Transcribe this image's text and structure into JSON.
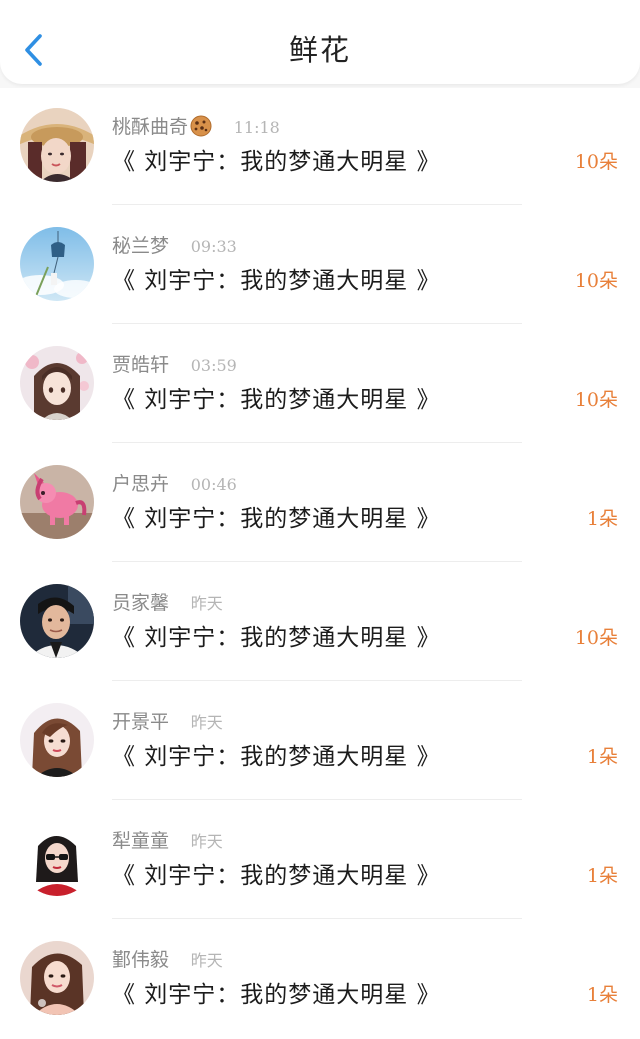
{
  "header": {
    "title": "鲜花",
    "back_icon": "chevron-left-icon"
  },
  "colors": {
    "accent": "#2f8fe3",
    "count": "#e8803a",
    "name": "#8a8a8a",
    "time": "#b5b5b5",
    "message": "#1c1c1c"
  },
  "items": [
    {
      "name": "桃酥曲奇",
      "emoji": "cookie-emoji",
      "time": "11:18",
      "message": "《 刘宇宁：我的梦通大明星 》",
      "count": "10朵"
    },
    {
      "name": "秘兰梦",
      "time": "09:33",
      "message": "《 刘宇宁：我的梦通大明星 》",
      "count": "10朵"
    },
    {
      "name": "贾皓轩",
      "time": "03:59",
      "message": "《 刘宇宁：我的梦通大明星 》",
      "count": "10朵"
    },
    {
      "name": "户思卉",
      "time": "00:46",
      "message": "《 刘宇宁：我的梦通大明星 》",
      "count": "1朵"
    },
    {
      "name": "员家馨",
      "time": "昨天",
      "message": "《 刘宇宁：我的梦通大明星 》",
      "count": "10朵"
    },
    {
      "name": "开景平",
      "time": "昨天",
      "message": "《 刘宇宁：我的梦通大明星 》",
      "count": "1朵"
    },
    {
      "name": "犁童童",
      "time": "昨天",
      "message": "《 刘宇宁：我的梦通大明星 》",
      "count": "1朵"
    },
    {
      "name": "鄞伟毅",
      "time": "昨天",
      "message": "《 刘宇宁：我的梦通大明星 》",
      "count": "1朵"
    }
  ]
}
